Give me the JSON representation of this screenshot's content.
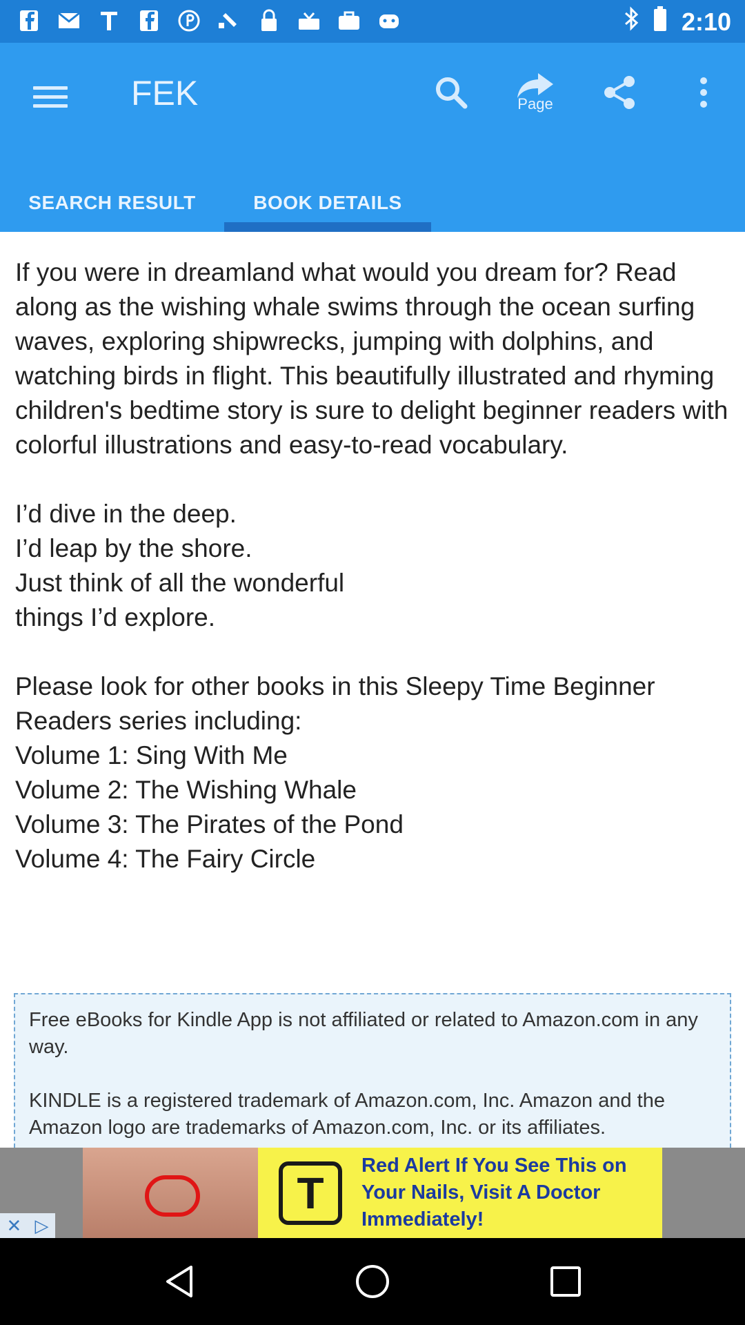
{
  "status_bar": {
    "time": "2:10",
    "icons": [
      "facebook-icon",
      "mail-icon",
      "t-icon",
      "facebook-icon",
      "pinterest-icon",
      "satellite-icon",
      "lock-icon",
      "inbox-icon",
      "briefcase-icon",
      "android-icon",
      "bluetooth-icon",
      "battery-icon"
    ]
  },
  "app_bar": {
    "title": "FEK",
    "page_label": "Page",
    "tabs": [
      {
        "label": "SEARCH RESULT",
        "active": false
      },
      {
        "label": "BOOK DETAILS",
        "active": true
      }
    ]
  },
  "content": {
    "description": "If you were in dreamland what would you dream for? Read along as the wishing whale swims through the ocean surfing waves, exploring shipwrecks, jumping with dolphins, and watching birds in flight. This beautifully illustrated and rhyming children's bedtime story is sure to delight beginner readers with colorful illustrations and easy-to-read vocabulary.\n\nI’d dive in the deep.\nI’d leap by the shore.\nJust think of all the wonderful\nthings I’d explore.\n\nPlease look for other books in this Sleepy Time Beginner Readers series including:\nVolume 1: Sing With Me\nVolume 2: The Wishing Whale\nVolume 3: The Pirates of the Pond\nVolume 4: The Fairy Circle",
    "notice": "Free eBooks for Kindle App is not affiliated or related to Amazon.com in any way.\n\nKINDLE is a registered trademark of Amazon.com, Inc. Amazon and the Amazon logo are trademarks of Amazon.com, Inc. or its affiliates."
  },
  "ad": {
    "logo_letter": "T",
    "text": "Red Alert If You See This on\nYour Nails, Visit A Doctor\nImmediately!"
  },
  "colors": {
    "status_bar": "#1e7fd6",
    "app_bar": "#2f9bef",
    "tab_indicator": "#1f6fc4",
    "ad_background": "#f7f24a"
  }
}
